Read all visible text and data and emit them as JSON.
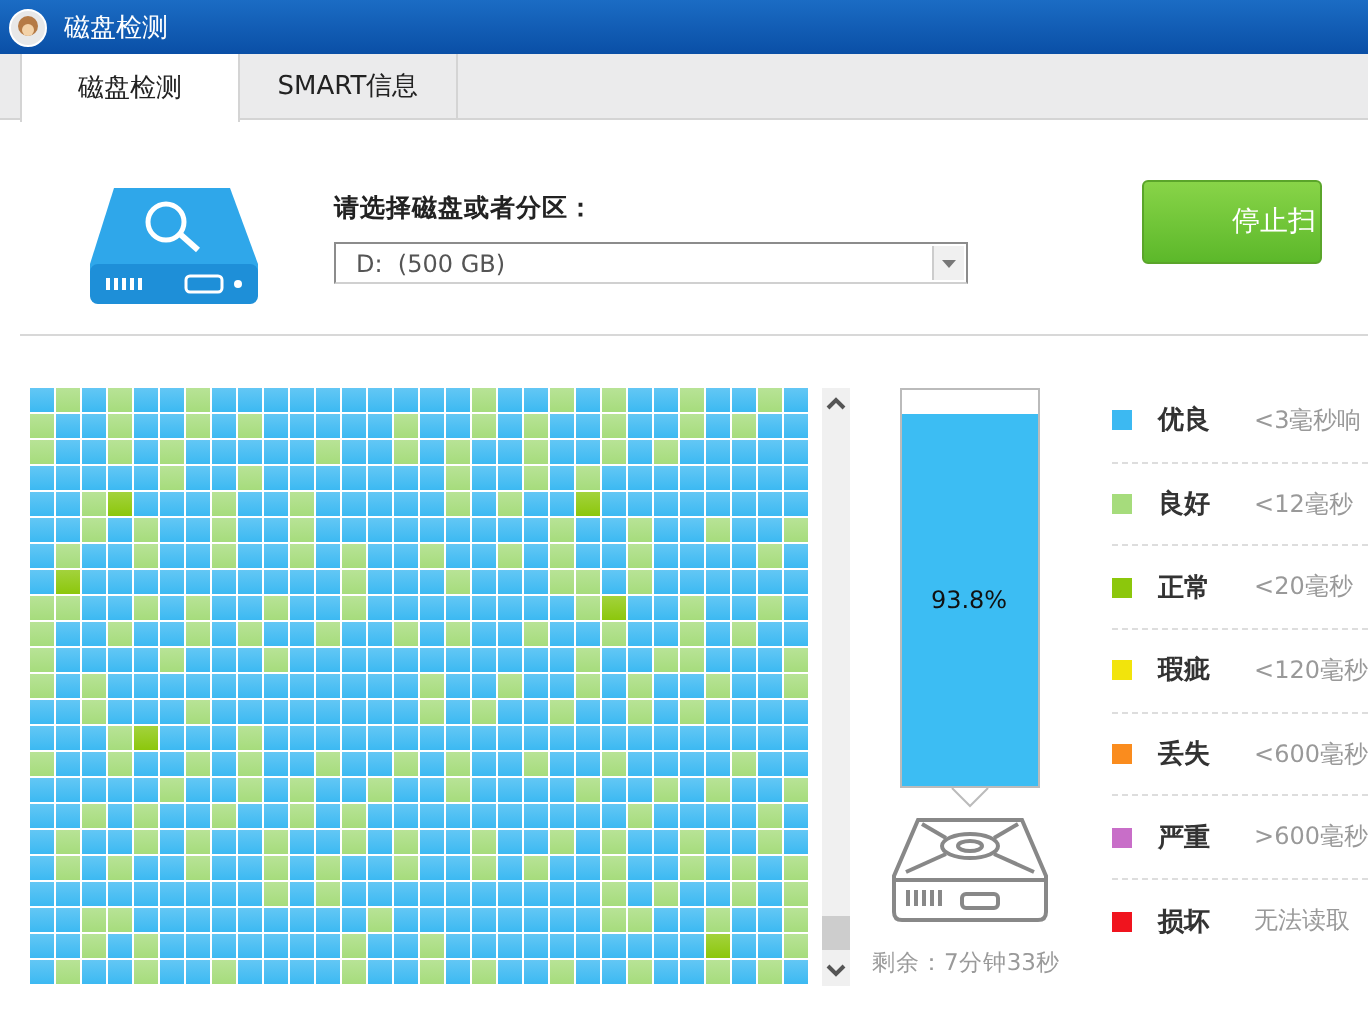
{
  "window": {
    "title": "磁盘检测"
  },
  "tabs": [
    {
      "label": "磁盘检测",
      "selected": true
    },
    {
      "label": "SMART信息",
      "selected": false
    }
  ],
  "disk_select": {
    "label": "请选择磁盘或者分区：",
    "value": "D:  (500 GB)"
  },
  "stop_button": {
    "label": "停止扫"
  },
  "progress": {
    "level": 0.938,
    "reading": "93.8%"
  },
  "remaining": "剩余：7分钟33秒",
  "legend": [
    {
      "name": "优良",
      "description": "<3毫秒响",
      "color": "#3cb9f2"
    },
    {
      "name": "良好",
      "description": "<12毫秒",
      "color": "#a6dc7c"
    },
    {
      "name": "正常",
      "description": "<20毫秒",
      "color": "#8cc70c"
    },
    {
      "name": "瑕疵",
      "description": "<120毫秒",
      "color": "#f2e40c"
    },
    {
      "name": "丢失",
      "description": "<600毫秒",
      "color": "#fa8c1e"
    },
    {
      "name": "严重",
      "description": ">600毫秒",
      "color": "#c86ec8"
    },
    {
      "name": "损坏",
      "description": "无法读取",
      "color": "#f0141e"
    }
  ]
}
